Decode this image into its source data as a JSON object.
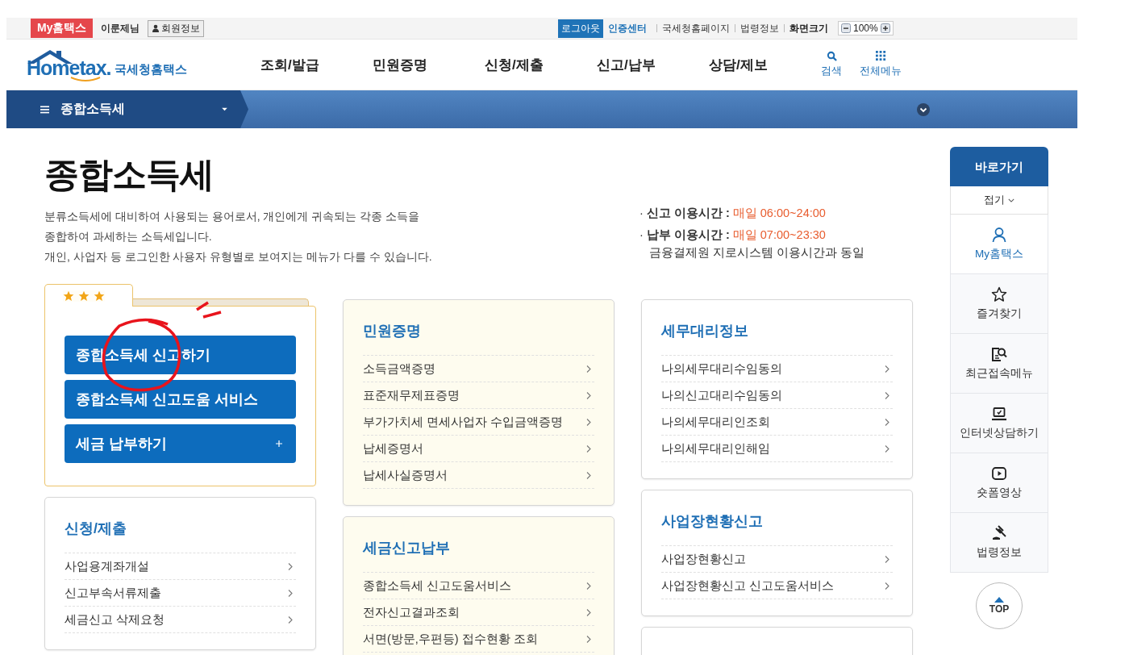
{
  "utility_bar": {
    "my_hometax": "My홈택스",
    "user_name": "이룬제님",
    "member_info": "회원정보",
    "logout": "로그아웃",
    "cert_center": "인증센터",
    "links": [
      "국세청홈페이지",
      "법령정보"
    ],
    "screen_size_label": "화면크기",
    "zoom_value": "100%"
  },
  "header": {
    "logo_text": "Hometax.",
    "logo_subtitle": "국세청홈택스",
    "nav": [
      "조회/발급",
      "민원증명",
      "신청/제출",
      "신고/납부",
      "상담/제보"
    ],
    "search": "검색",
    "all_menu": "전체메뉴"
  },
  "menu_bar": {
    "current": "종합소득세"
  },
  "page": {
    "title": "종합소득세",
    "description": [
      "분류소득세에 대비하여 사용되는 용어로서, 개인에게 귀속되는 각종 소득을",
      "종합하여 과세하는 소득세입니다.",
      "개인, 사업자 등 로그인한 사용자 유형별로 보여지는 메뉴가 다를 수 있습니다."
    ],
    "hours": [
      {
        "bullet": "·",
        "label": "신고 이용시간 :",
        "value": "매일 06:00~24:00"
      },
      {
        "bullet": "·",
        "label": "납부 이용시간 :",
        "value": "매일 07:00~23:30",
        "note": "금융결제원 지로시스템 이용시간과 동일"
      }
    ]
  },
  "favorites": {
    "stars": 3,
    "buttons": [
      {
        "label": "종합소득세 신고하기",
        "kind": "plain"
      },
      {
        "label": "종합소득세 신고도움 서비스",
        "kind": "plain"
      },
      {
        "label": "세금 납부하기",
        "kind": "expand"
      }
    ]
  },
  "columns": [
    [
      {
        "title": "신청/제출",
        "kind": "plain",
        "items": [
          "사업용계좌개설",
          "신고부속서류제출",
          "세금신고 삭제요청"
        ]
      }
    ],
    [
      {
        "title": "민원증명",
        "kind": "yellow",
        "items": [
          "소득금액증명",
          "표준재무제표증명",
          "부가가치세 면세사업자 수입금액증명",
          "납세증명서",
          "납세사실증명서"
        ]
      },
      {
        "title": "세금신고납부",
        "kind": "yellow",
        "items": [
          "종합소득세 신고도움서비스",
          "전자신고결과조회",
          "서면(방문,우편등) 접수현황 조회"
        ]
      }
    ],
    [
      {
        "title": "세무대리정보",
        "kind": "plain",
        "items": [
          "나의세무대리수임동의",
          "나의신고대리수임동의",
          "나의세무대리인조회",
          "나의세무대리인해임"
        ]
      },
      {
        "title": "사업장현황신고",
        "kind": "plain",
        "items": [
          "사업장현황신고",
          "사업장현황신고 신고도움서비스"
        ]
      }
    ]
  ],
  "quick_menu": {
    "title": "바로가기",
    "collapse": "접기",
    "items": [
      {
        "label": "My홈택스",
        "kind": "user",
        "selected": true
      },
      {
        "label": "즐겨찾기",
        "kind": "star",
        "selected": false
      },
      {
        "label": "최근접속메뉴",
        "kind": "recent",
        "selected": false
      },
      {
        "label": "인터넷상담하기",
        "kind": "consult",
        "selected": false
      },
      {
        "label": "숏폼영상",
        "kind": "video",
        "selected": false
      },
      {
        "label": "법령정보",
        "kind": "law",
        "selected": false
      }
    ],
    "top": "TOP"
  }
}
